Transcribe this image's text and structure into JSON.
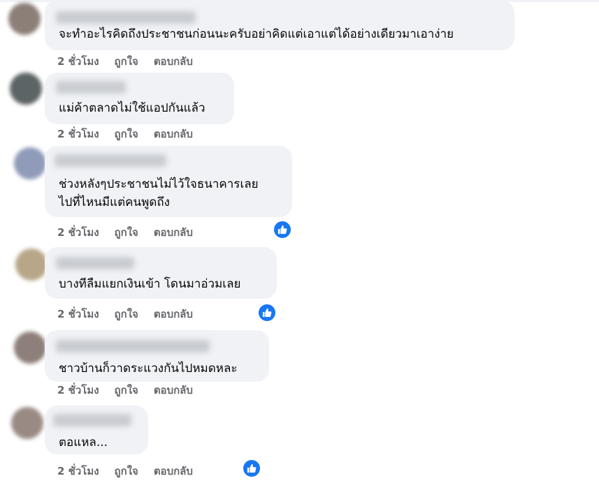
{
  "comments": [
    {
      "text_lines": [
        "จะทำอะไรคิดถึงประชาชนก่อนนะครับอย่าคิดแต่เอาแต่ได้อย่างเดียวมาเอาง่าย"
      ],
      "time": "2 ชั่วโมง",
      "like": "ถูกใจ",
      "reply": "ตอบกลับ",
      "has_like_badge": false
    },
    {
      "text_lines": [
        "แม่ค้าตลาดไม่ใช้แอปกันแล้ว"
      ],
      "time": "2 ชั่วโมง",
      "like": "ถูกใจ",
      "reply": "ตอบกลับ",
      "has_like_badge": false
    },
    {
      "text_lines": [
        "ช่วงหลังๆประชาชนไม่ไว้ใจธนาคารเลย",
        "ไปที่ไหนมีแต่คนพูดถึง"
      ],
      "time": "2 ชั่วโมง",
      "like": "ถูกใจ",
      "reply": "ตอบกลับ",
      "has_like_badge": true
    },
    {
      "text_lines": [
        "บางทีลืมแยกเงินเข้า โดนมาอ่วมเลย"
      ],
      "time": "2 ชั่วโมง",
      "like": "ถูกใจ",
      "reply": "ตอบกลับ",
      "has_like_badge": true
    },
    {
      "text_lines": [
        "ชาวบ้านก็วาดระแวงกันไปหมดหละ"
      ],
      "time": "2 ชั่วโมง",
      "like": "ถูกใจ",
      "reply": "ตอบกลับ",
      "has_like_badge": false
    },
    {
      "text_lines": [
        "ตอแหล..."
      ],
      "time": "2 ชั่วโมง",
      "like": "ถูกใจ",
      "reply": "ตอบกลับ",
      "has_like_badge": true
    }
  ],
  "icons": {
    "like_badge": "thumbs-up-icon"
  },
  "colors": {
    "bubble": "#f0f2f5",
    "meta_text": "#65676b",
    "like_blue": "#1877f2"
  }
}
